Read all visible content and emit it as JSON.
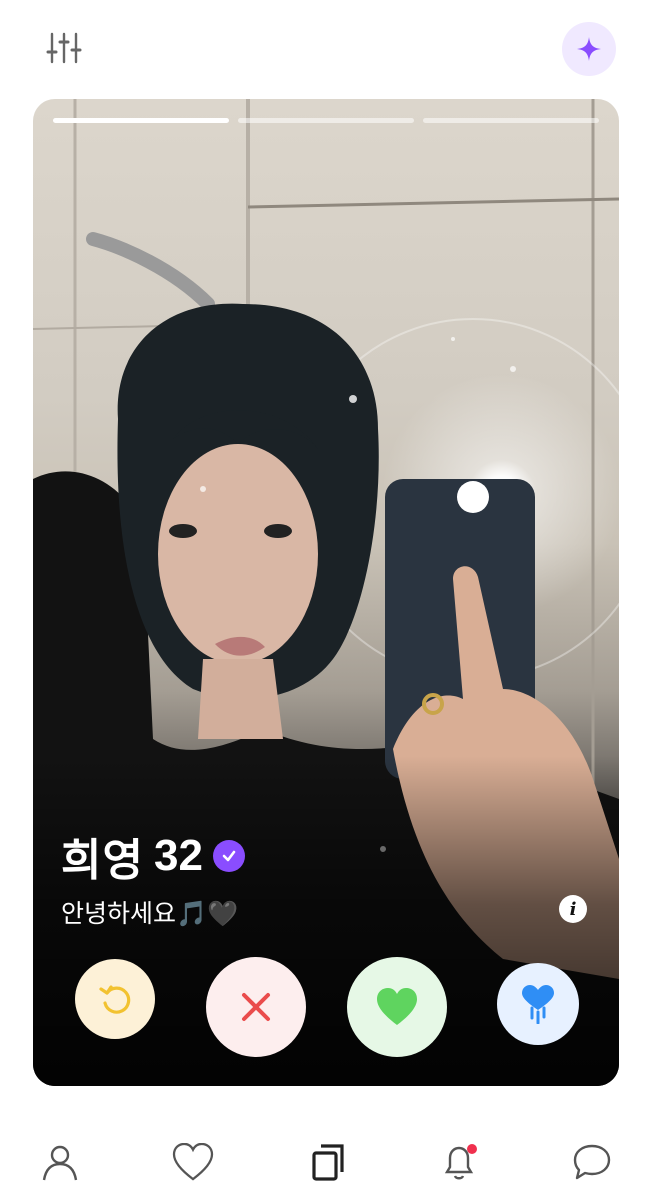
{
  "header": {
    "filter_icon": "sliders-icon",
    "boost_icon": "sparkle-icon",
    "accent": "#8a4dff"
  },
  "card": {
    "photo_count": 3,
    "active_photo_index": 0,
    "name": "희영",
    "age": "32",
    "verified_icon": "verified-badge-icon",
    "bio": "안녕하세요🎵🖤",
    "info_icon": "info-icon"
  },
  "actions": [
    {
      "name": "rewind",
      "icon": "undo-icon",
      "color": "#f2c230"
    },
    {
      "name": "nope",
      "icon": "x-icon",
      "color": "#ea4c4c"
    },
    {
      "name": "like",
      "icon": "heart-icon",
      "color": "#5fd45f"
    },
    {
      "name": "super-like",
      "icon": "frozen-heart-icon",
      "color": "#2f8ef5"
    }
  ],
  "nav": {
    "items": [
      {
        "name": "profile",
        "icon": "person-icon"
      },
      {
        "name": "likes",
        "icon": "heart-outline-icon"
      },
      {
        "name": "discover",
        "icon": "cards-icon"
      },
      {
        "name": "notifications",
        "icon": "bell-icon",
        "has_badge": true
      },
      {
        "name": "messages",
        "icon": "chat-icon"
      }
    ],
    "badge_color": "#f0304e"
  }
}
